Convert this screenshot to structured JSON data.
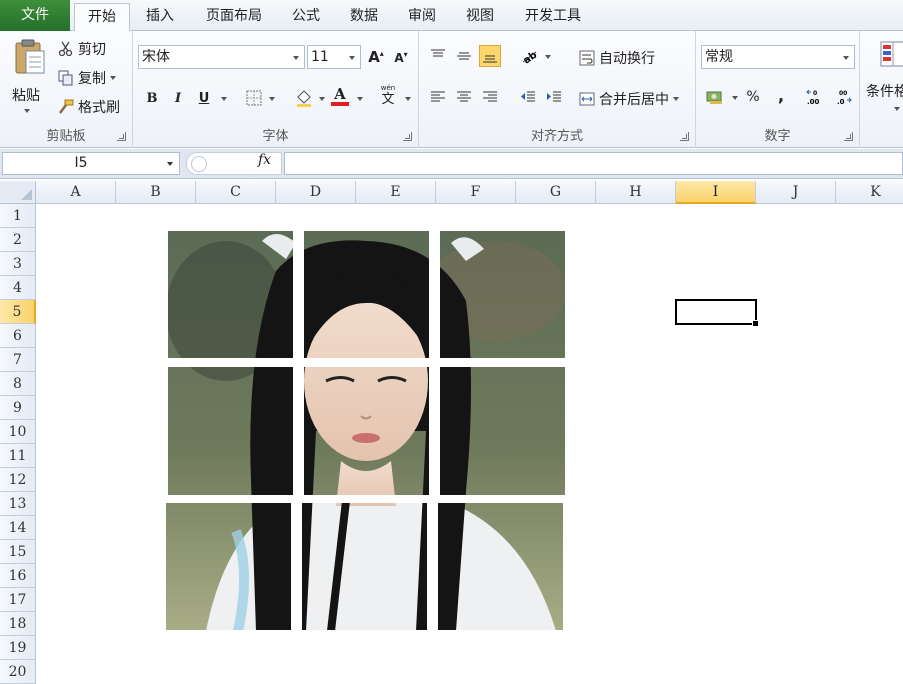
{
  "tabs": [
    {
      "label": "文件"
    },
    {
      "label": "开始"
    },
    {
      "label": "插入"
    },
    {
      "label": "页面布局"
    },
    {
      "label": "公式"
    },
    {
      "label": "数据"
    },
    {
      "label": "审阅"
    },
    {
      "label": "视图"
    },
    {
      "label": "开发工具"
    }
  ],
  "clipboard": {
    "paste": "粘贴",
    "cut": "剪切",
    "copy": "复制",
    "format_painter": "格式刷",
    "label": "剪贴板"
  },
  "font": {
    "name": "宋体",
    "size": "11",
    "bold": "B",
    "italic": "I",
    "underline": "U",
    "label": "字体",
    "wen": "wén",
    "wen_char": "文"
  },
  "alignment": {
    "wrap_text": "自动换行",
    "merge_center": "合并后居中",
    "label": "对齐方式"
  },
  "number": {
    "format": "常规",
    "percent": "%",
    "comma": ",",
    "label": "数字"
  },
  "styles": {
    "conditional": "条件格"
  },
  "formula_bar": {
    "name_box": "I5",
    "fx": "fx",
    "content": ""
  },
  "columns": [
    "A",
    "B",
    "C",
    "D",
    "E",
    "F",
    "G",
    "H",
    "I",
    "J",
    "K"
  ],
  "rows": [
    "1",
    "2",
    "3",
    "4",
    "5",
    "6",
    "7",
    "8",
    "9",
    "10",
    "11",
    "12",
    "13",
    "14",
    "15",
    "16",
    "17",
    "18",
    "19",
    "20"
  ],
  "selected_column": "I",
  "selected_row": "5",
  "colors": {
    "file_tab": "#2e7d32",
    "selection": "#f9d36b",
    "ribbon_bg": "#eef2f8"
  }
}
